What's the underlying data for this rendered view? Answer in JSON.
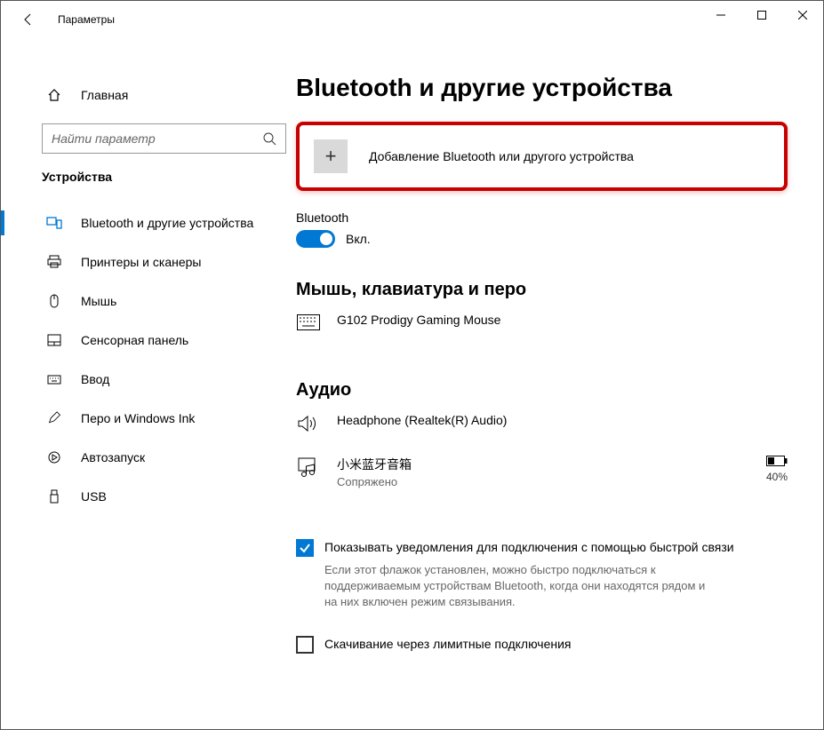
{
  "window": {
    "title": "Параметры"
  },
  "sidebar": {
    "home": "Главная",
    "search_placeholder": "Найти параметр",
    "section": "Устройства",
    "items": [
      {
        "label": "Bluetooth и другие устройства"
      },
      {
        "label": "Принтеры и сканеры"
      },
      {
        "label": "Мышь"
      },
      {
        "label": "Сенсорная панель"
      },
      {
        "label": "Ввод"
      },
      {
        "label": "Перо и Windows Ink"
      },
      {
        "label": "Автозапуск"
      },
      {
        "label": "USB"
      }
    ]
  },
  "main": {
    "title": "Bluetooth и другие устройства",
    "add_device": "Добавление Bluetooth или другого устройства",
    "bluetooth_label": "Bluetooth",
    "bluetooth_state": "Вкл.",
    "sections": {
      "mouse": {
        "title": "Мышь, клавиатура и перо",
        "devices": [
          {
            "name": "G102 Prodigy Gaming Mouse"
          }
        ]
      },
      "audio": {
        "title": "Аудио",
        "devices": [
          {
            "name": "Headphone (Realtek(R) Audio)"
          },
          {
            "name": "小米蓝牙音箱",
            "status": "Сопряжено",
            "battery": "40%"
          }
        ]
      }
    },
    "checkbox1_label": "Показывать уведомления для подключения с помощью быстрой связи",
    "checkbox1_desc": "Если этот флажок установлен, можно быстро подключаться к поддерживаемым устройствам Bluetooth, когда они находятся рядом и на них включен режим связывания.",
    "checkbox2_label": "Скачивание через лимитные подключения"
  }
}
